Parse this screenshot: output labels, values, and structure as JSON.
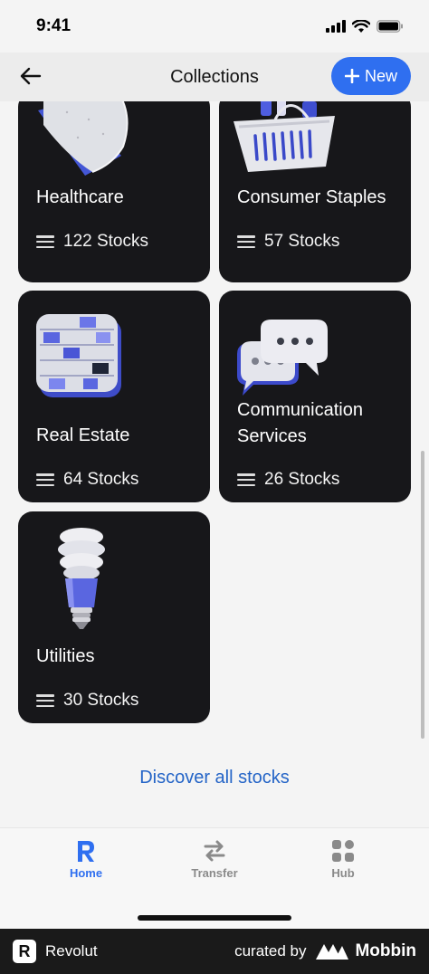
{
  "status": {
    "time": "9:41"
  },
  "nav": {
    "title": "Collections",
    "new_label": "New"
  },
  "collections": [
    {
      "title": "Healthcare",
      "count": "122 Stocks"
    },
    {
      "title": "Consumer Staples",
      "count": "57 Stocks"
    },
    {
      "title": "Real Estate",
      "count": "64 Stocks"
    },
    {
      "title_line1": "Communication",
      "title_line2": "Services",
      "count": "26 Stocks"
    },
    {
      "title": "Utilities",
      "count": "30 Stocks"
    }
  ],
  "discover_label": "Discover all stocks",
  "tabs": [
    {
      "label": "Home",
      "icon": "revolut-r-icon",
      "active": true
    },
    {
      "label": "Transfer",
      "icon": "transfer-arrows-icon",
      "active": false
    },
    {
      "label": "Hub",
      "icon": "hub-grid-icon",
      "active": false
    }
  ],
  "footer": {
    "brand": "Revolut",
    "curated": "curated by",
    "source": "Mobbin"
  },
  "colors": {
    "accent": "#2f6ff0",
    "card": "#17171a",
    "link": "#2565c7"
  }
}
